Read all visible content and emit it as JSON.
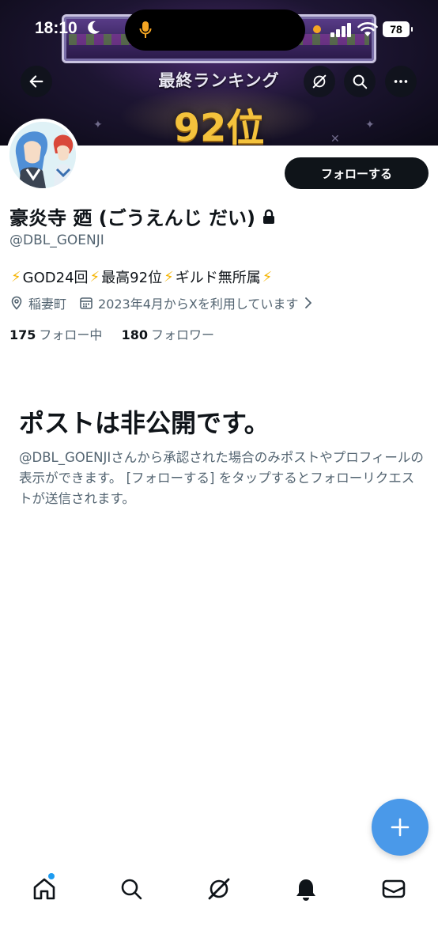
{
  "status_bar": {
    "time": "18:10",
    "battery": "78"
  },
  "banner": {
    "heading": "最終ランキング",
    "rank": "92位"
  },
  "profile": {
    "display_name": "豪炎寺 廼 (ごうえんじ だい)",
    "handle": "@DBL_GOENJI",
    "bio": {
      "parts": [
        "GOD24回",
        "最高92位",
        "ギルド無所属"
      ]
    },
    "location": "稲妻町",
    "joined": "2023年4月からXを利用しています",
    "following_count": "175",
    "following_label": "フォロー中",
    "followers_count": "180",
    "followers_label": "フォロワー",
    "follow_button_label": "フォローする"
  },
  "private_notice": {
    "title": "ポストは非公開です。",
    "body": "@DBL_GOENJIさんから承認された場合のみポストやプロフィールの表示ができます。 [フォローする] をタップするとフォローリクエストが送信されます。"
  },
  "icons": {
    "back": "arrow-left-icon",
    "grok": "grok-icon",
    "search": "search-icon",
    "more": "more-dots-icon",
    "lock": "lock-icon",
    "location": "location-pin-icon",
    "calendar": "calendar-icon",
    "chevron": "chevron-right-icon",
    "compose": "plus-icon",
    "tabs": [
      "home-icon",
      "search-icon",
      "grok-icon",
      "bell-icon",
      "mail-icon"
    ]
  },
  "colors": {
    "accent": "#1d9bf0",
    "fab": "#4a99e9",
    "rank_gold": "#f4c23c",
    "bolt": "#f5b400",
    "text_primary": "#0f1419",
    "text_secondary": "#536471"
  }
}
